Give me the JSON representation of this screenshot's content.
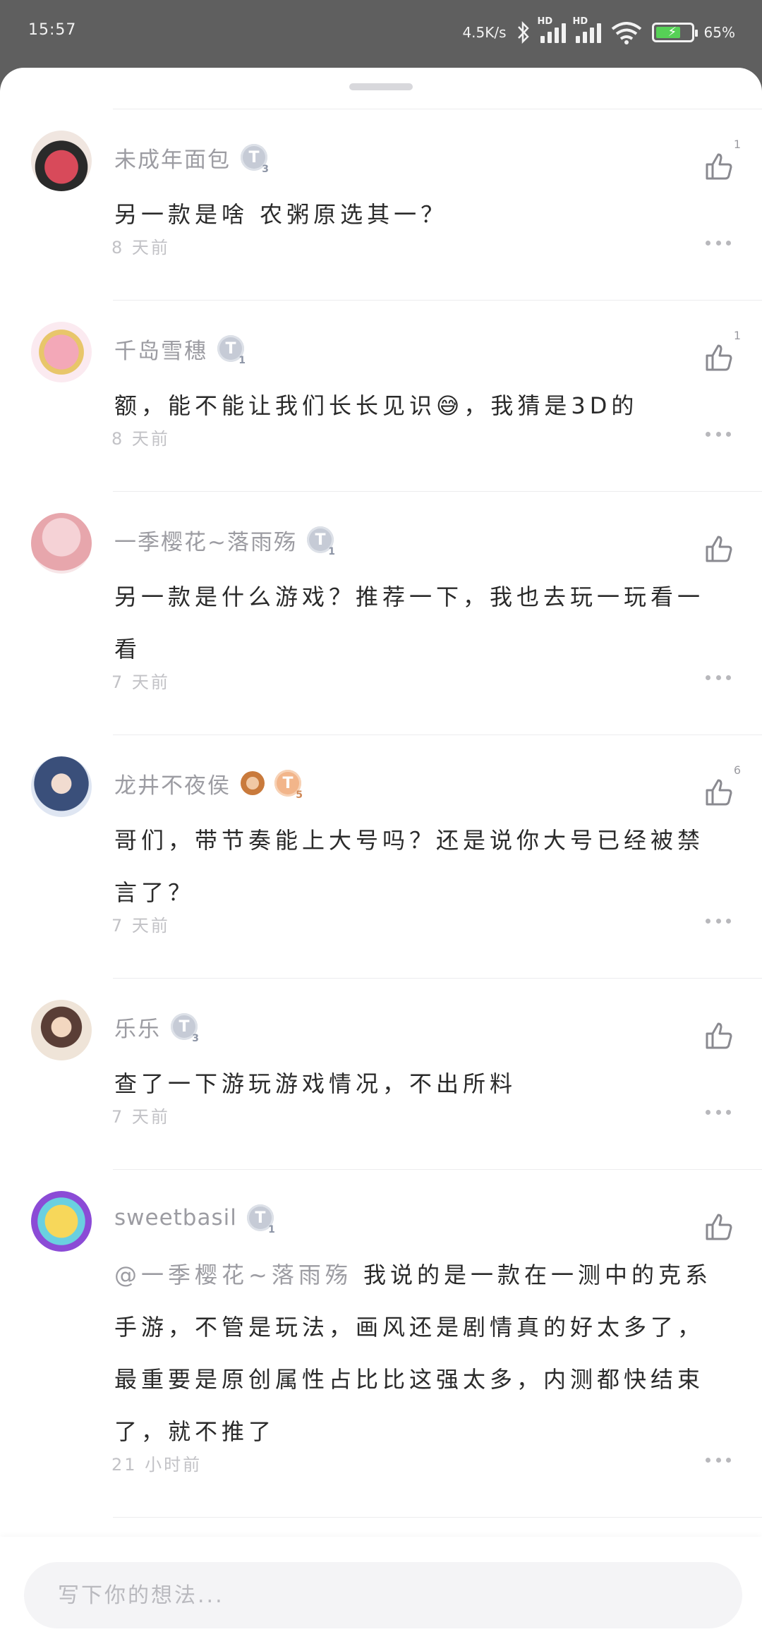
{
  "status_bar": {
    "time": "15:57",
    "net_speed": "4.5K/s",
    "hd1": "HD",
    "hd2": "HD",
    "battery": "65%"
  },
  "comments": [
    {
      "user": "未成年面包",
      "badge": "T",
      "badge_level": "3",
      "text": "另一款是啥 农粥原选其一？",
      "time": "8 天前",
      "likes": "1"
    },
    {
      "user": "千岛雪穗",
      "badge": "T",
      "badge_level": "1",
      "text": "额，能不能让我们长长见识😅，我猜是3D的",
      "time": "8 天前",
      "likes": "1"
    },
    {
      "user": "一季樱花~落雨殇",
      "badge": "T",
      "badge_level": "1",
      "text": "另一款是什么游戏？推荐一下，我也去玩一玩看一看",
      "time": "7 天前",
      "likes": ""
    },
    {
      "user": "龙井不夜侯",
      "badge": "T",
      "badge_level": "5",
      "text": "哥们，带节奏能上大号吗？还是说你大号已经被禁言了？",
      "time": "7 天前",
      "likes": "6"
    },
    {
      "user": "乐乐",
      "badge": "T",
      "badge_level": "3",
      "text": "查了一下游玩游戏情况，不出所料",
      "time": "7 天前",
      "likes": ""
    },
    {
      "user": "sweetbasil",
      "badge": "T",
      "badge_level": "1",
      "mention": "@一季樱花~落雨殇",
      "text": " 我说的是一款在一测中的克系手游，不管是玩法，画风还是剧情真的好太多了，最重要是原创属性占比比这强太多，内测都快结束了，就不推了",
      "time": "21 小时前",
      "likes": ""
    }
  ],
  "input": {
    "placeholder": "写下你的想法..."
  },
  "colors": {
    "status_bar_bg": "#5f5f5f",
    "sheet_bg": "#ffffff",
    "name_gray": "#9c9ca2",
    "badge_silver": "#c6cbd6",
    "badge_gold": "#f2b58a"
  }
}
